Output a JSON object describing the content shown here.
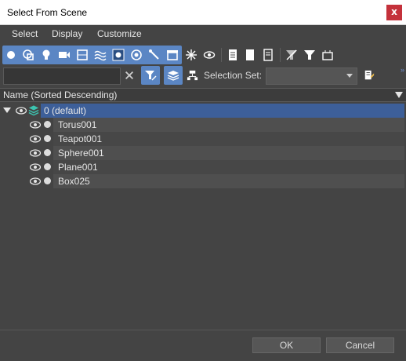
{
  "window": {
    "title": "Select From Scene",
    "close_glyph": "x"
  },
  "menu": {
    "items": [
      "Select",
      "Display",
      "Customize"
    ]
  },
  "toolbar": {
    "object_type_buttons": [
      "geometry-icon",
      "shapes-icon",
      "lights-icon",
      "cameras-icon",
      "helpers-icon",
      "space-warps-icon",
      "groups-icon",
      "xrefs-icon",
      "bone-icon",
      "containers-icon",
      "frozen-icon"
    ],
    "accent": "#5b86c4"
  },
  "filter_row": {
    "search_value": "",
    "selection_set_label": "Selection Set:",
    "selection_set_value": ""
  },
  "column_header": {
    "label": "Name (Sorted Descending)"
  },
  "tree": {
    "root": {
      "label": "0 (default)",
      "expanded": true,
      "highlight": "#3d5f99"
    },
    "children": [
      {
        "label": "Torus001"
      },
      {
        "label": "Teapot001"
      },
      {
        "label": "Sphere001"
      },
      {
        "label": "Plane001"
      },
      {
        "label": "Box025"
      }
    ]
  },
  "buttons": {
    "ok": "OK",
    "cancel": "Cancel"
  }
}
